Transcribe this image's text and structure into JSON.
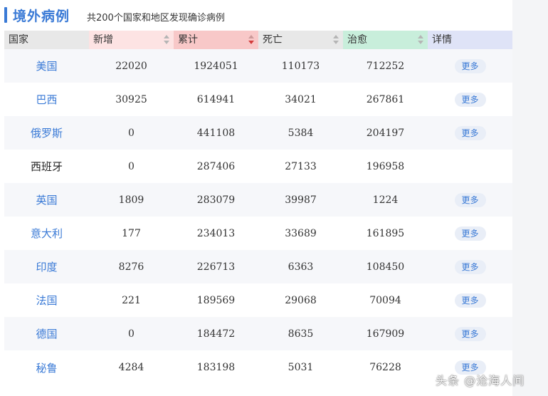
{
  "header": {
    "title": "境外病例",
    "subtitle": "共200个国家和地区发现确诊病例"
  },
  "table": {
    "columns": [
      {
        "label": "国家",
        "bg": "#e8e8e8",
        "sortable": false
      },
      {
        "label": "新增",
        "bg": "#fde3e3",
        "sortable": true,
        "active": false
      },
      {
        "label": "累计",
        "bg": "#f8c8c8",
        "sortable": true,
        "active": true
      },
      {
        "label": "死亡",
        "bg": "#e8e8e8",
        "sortable": true,
        "active": false
      },
      {
        "label": "治愈",
        "bg": "#c8eedb",
        "sortable": true,
        "active": false
      },
      {
        "label": "详情",
        "bg": "#dfe3f7",
        "sortable": false
      }
    ],
    "more_label": "更多",
    "rows": [
      {
        "country": "美国",
        "new": "22020",
        "total": "1924051",
        "deaths": "110173",
        "recovered": "712252",
        "more": true
      },
      {
        "country": "巴西",
        "new": "30925",
        "total": "614941",
        "deaths": "34021",
        "recovered": "267861",
        "more": true
      },
      {
        "country": "俄罗斯",
        "new": "0",
        "total": "441108",
        "deaths": "5384",
        "recovered": "204197",
        "more": true
      },
      {
        "country": "西班牙",
        "new": "0",
        "total": "287406",
        "deaths": "27133",
        "recovered": "196958",
        "more": false
      },
      {
        "country": "英国",
        "new": "1809",
        "total": "283079",
        "deaths": "39987",
        "recovered": "1224",
        "more": true
      },
      {
        "country": "意大利",
        "new": "177",
        "total": "234013",
        "deaths": "33689",
        "recovered": "161895",
        "more": true
      },
      {
        "country": "印度",
        "new": "8276",
        "total": "226713",
        "deaths": "6363",
        "recovered": "108450",
        "more": true
      },
      {
        "country": "法国",
        "new": "221",
        "total": "189569",
        "deaths": "29068",
        "recovered": "70094",
        "more": true
      },
      {
        "country": "德国",
        "new": "0",
        "total": "184472",
        "deaths": "8635",
        "recovered": "167909",
        "more": true
      },
      {
        "country": "秘鲁",
        "new": "4284",
        "total": "183198",
        "deaths": "5031",
        "recovered": "76228",
        "more": true
      }
    ]
  },
  "watermark": "头条 @沧海人间",
  "colors": {
    "accent": "#3a7ad6",
    "sort_active": "#d23b3b"
  }
}
